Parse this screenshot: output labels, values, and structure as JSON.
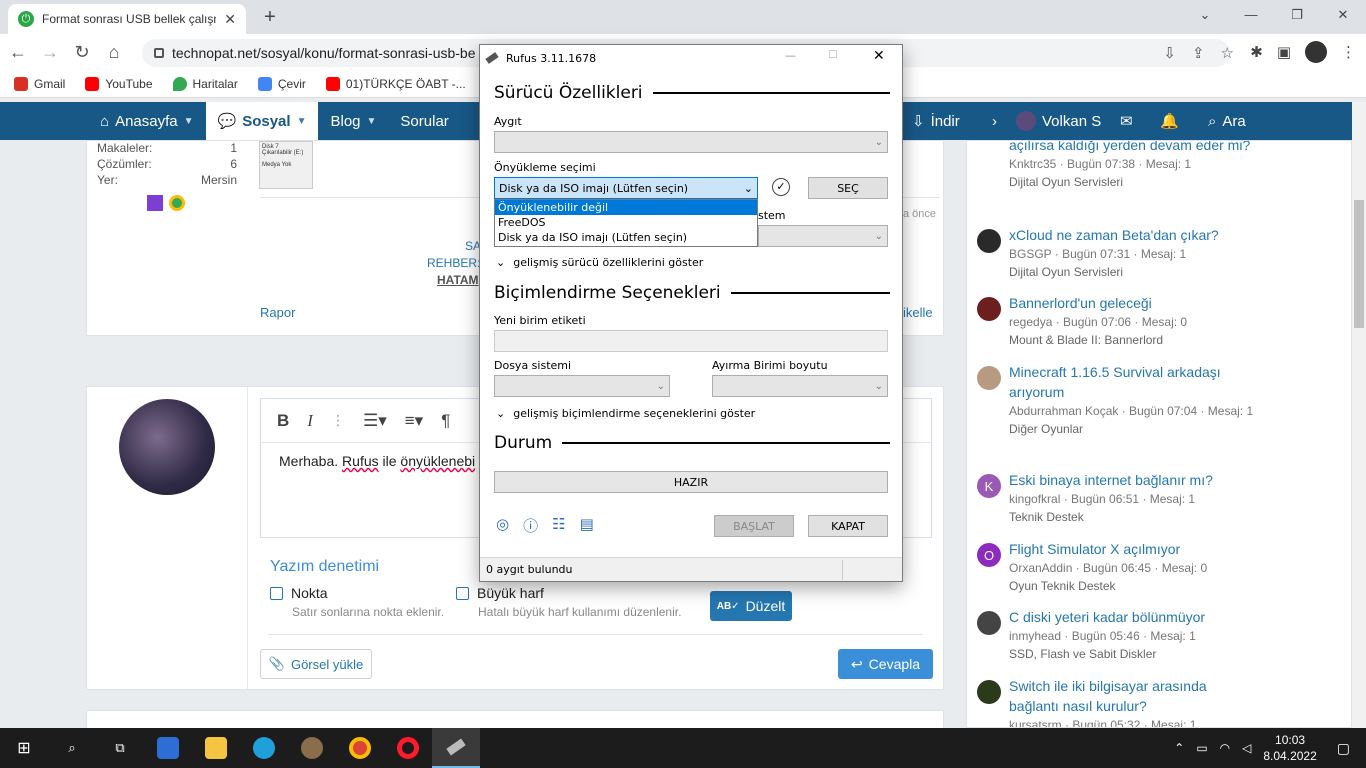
{
  "browser": {
    "tab_title": "Format sonrası USB bellek çalışm",
    "url": "technopat.net/sosyal/konu/format-sonrasi-usb-be"
  },
  "bookmarks": [
    {
      "label": "Gmail",
      "color": "#d93025"
    },
    {
      "label": "YouTube",
      "color": "#ff0000"
    },
    {
      "label": "Haritalar",
      "color": "#34a853"
    },
    {
      "label": "Çevir",
      "color": "#4285f4"
    },
    {
      "label": "01)TÜRKÇE ÖABT -...",
      "color": "#ff0000"
    }
  ],
  "nav": {
    "home": "Anasayfa",
    "social": "Sosyal",
    "blog": "Blog",
    "questions": "Sorular",
    "download": "İndir",
    "user": "Volkan S",
    "search": "Ara"
  },
  "post": {
    "makaleler_label": "Makaleler:",
    "makaleler_value": "1",
    "cozumler_label": "Çözümler:",
    "cozumler_value": "6",
    "yer_label": "Yer:",
    "yer_value": "Mersin",
    "img_caption1": "Disk 7",
    "img_caption2": "Çıkarılabilir (E:)",
    "img_caption3": "Medya Yok",
    "frag1": "SA",
    "frag2": "REHBER: Ç",
    "frag3": "HATAM",
    "report": "Rapor",
    "time_frag": "a önce",
    "react_frag": "ikelle"
  },
  "editor": {
    "text_plain": "Merhaba. ",
    "text_word1": "Rufus",
    "text_mid": " ile ",
    "text_word2": "önyüklenebi"
  },
  "spell": {
    "title": "Yazım denetimi",
    "opt1": "Nokta",
    "opt1_desc": "Satır sonlarına nokta eklenir.",
    "opt2": "Büyük harf",
    "opt2_desc": "Hatalı büyük harf kullanımı düzenlenir.",
    "fix": "Düzelt"
  },
  "actions": {
    "upload": "Görsel yükle",
    "reply": "Cevapla"
  },
  "sidebar": [
    {
      "title": "açılırsa kaldığı yerden devam eder mi?",
      "meta": "Knktrc35 · Bugün 07:38 · Mesaj: 1",
      "cat": "Dijital Oyun Servisleri",
      "color": "#555",
      "initial": ""
    },
    {
      "title": "xCloud ne zaman Beta'dan çıkar?",
      "meta": "BGSGP · Bugün 07:31 · Mesaj: 1",
      "cat": "Dijital Oyun Servisleri",
      "color": "#2a2a2a",
      "initial": ""
    },
    {
      "title": "Bannerlord'un geleceği",
      "meta": "regedya · Bugün 07:06 · Mesaj: 0",
      "cat": "Mount & Blade II: Bannerlord",
      "color": "#6b1f1f",
      "initial": ""
    },
    {
      "title": "Minecraft 1.16.5 Survival arkadaşı arıyorum",
      "meta": "Abdurrahman Koçak · Bugün 07:04 · Mesaj: 1",
      "cat": "Diğer Oyunlar",
      "color": "#b89a80",
      "initial": ""
    },
    {
      "title": "Eski binaya internet bağlanır mı?",
      "meta": "kingofkral · Bugün 06:51 · Mesaj: 1",
      "cat": "Teknik Destek",
      "color": "#9b59b6",
      "initial": "K"
    },
    {
      "title": "Flight Simulator X açılmıyor",
      "meta": "OrxanAddin · Bugün 06:45 · Mesaj: 0",
      "cat": "Oyun Teknik Destek",
      "color": "#8e2bbf",
      "initial": "O"
    },
    {
      "title": "C diski yeteri kadar bölünmüyor",
      "meta": "inmyhead · Bugün 05:46 · Mesaj: 1",
      "cat": "SSD, Flash ve Sabit Diskler",
      "color": "#444",
      "initial": ""
    },
    {
      "title": "Switch ile iki bilgisayar arasında bağlantı nasıl kurulur?",
      "meta": "kursatsrm · Bugün 05:32 · Mesaj: 1",
      "cat": "",
      "color": "#2c3a1c",
      "initial": ""
    }
  ],
  "rufus": {
    "title": "Rufus 3.11.1678",
    "sec_drive": "Sürücü Özellikleri",
    "device": "Aygıt",
    "boot_sel": "Önyükleme seçimi",
    "boot_value": "Disk ya da ISO imajı (Lütfen seçin)",
    "sec_btn": "SEÇ",
    "options": [
      "Önyüklenebilir değil",
      "FreeDOS",
      "Disk ya da ISO imajı (Lütfen seçin)"
    ],
    "partial": "stem",
    "adv_drive": "gelişmiş sürücü özelliklerini göster",
    "sec_format": "Biçimlendirme Seçenekleri",
    "volume_label": "Yeni birim etiketi",
    "fs": "Dosya sistemi",
    "cluster": "Ayırma Birimi boyutu",
    "adv_format": "gelişmiş biçimlendirme seçeneklerini göster",
    "sec_status": "Durum",
    "ready": "HAZIR",
    "start": "BAŞLAT",
    "close": "KAPAT",
    "status": "0 aygıt bulundu"
  },
  "taskbar": {
    "time": "10:03",
    "date": "8.04.2022"
  }
}
